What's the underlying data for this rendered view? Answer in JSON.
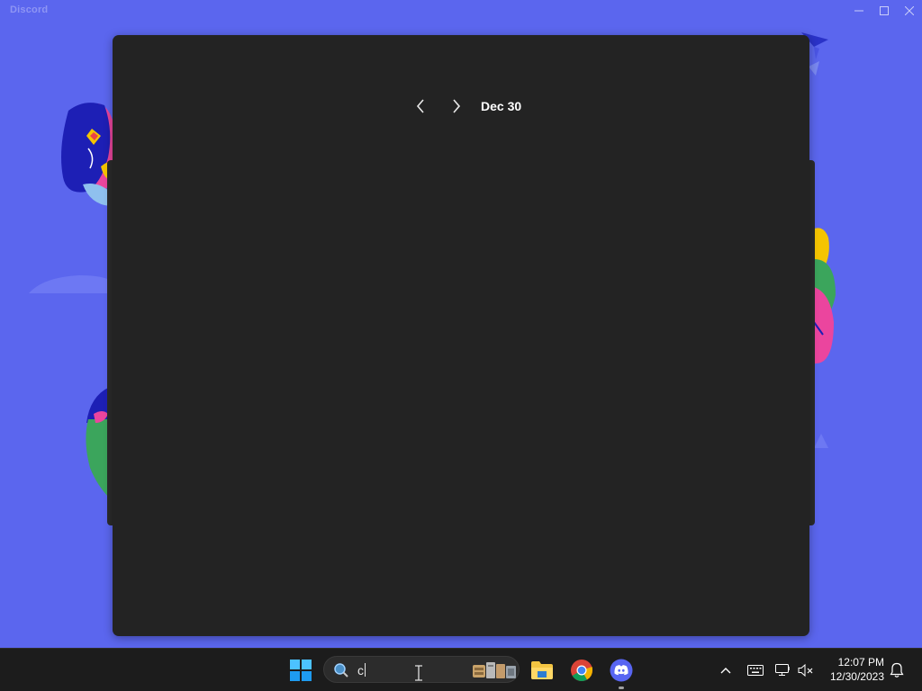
{
  "window": {
    "app_title": "Discord"
  },
  "calendar": {
    "date_label": "Dec 30"
  },
  "taskbar": {
    "search_text": "c",
    "clock_time": "12:07 PM",
    "clock_date": "12/30/2023",
    "pinned_apps": [
      "start-icon",
      "file-explorer-icon",
      "chrome-icon",
      "discord-icon"
    ],
    "tray_icons": [
      "chevron-up-icon",
      "keyboard-icon",
      "network-icon",
      "sound-muted-icon",
      "notification-bell-icon"
    ]
  },
  "colors": {
    "discord_blurple": "#5865f2",
    "flyout_background": "#232323",
    "taskbar_background": "#1c1c1c"
  }
}
